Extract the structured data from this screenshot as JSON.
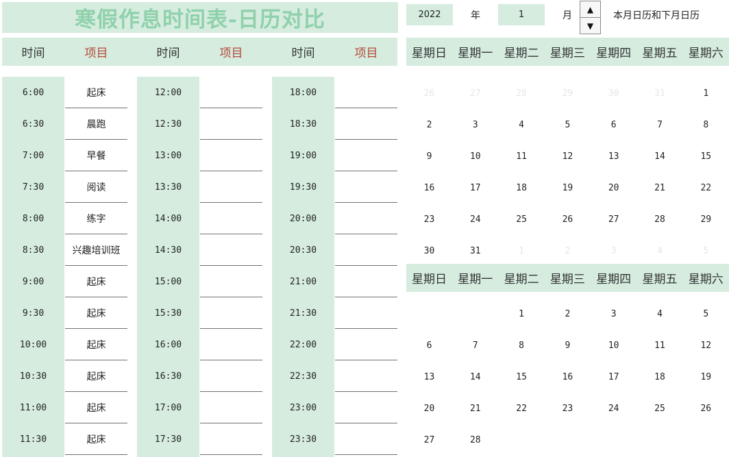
{
  "title": "寒假作息时间表-日历对比",
  "header": [
    "时间",
    "项目",
    "时间",
    "项目",
    "时间",
    "项目"
  ],
  "schedule": {
    "col1": {
      "times": [
        "6:00",
        "6:30",
        "7:00",
        "7:30",
        "8:00",
        "8:30",
        "9:00",
        "9:30",
        "10:00",
        "10:30",
        "11:00",
        "11:30"
      ],
      "items": [
        "起床",
        "晨跑",
        "早餐",
        "阅读",
        "练字",
        "兴趣培训班",
        "起床",
        "起床",
        "起床",
        "起床",
        "起床",
        "起床"
      ]
    },
    "col2": {
      "times": [
        "12:00",
        "12:30",
        "13:00",
        "13:30",
        "14:00",
        "14:30",
        "15:00",
        "15:30",
        "16:00",
        "16:30",
        "17:00",
        "17:30"
      ],
      "items": [
        "",
        "",
        "",
        "",
        "",
        "",
        "",
        "",
        "",
        "",
        "",
        ""
      ]
    },
    "col3": {
      "times": [
        "18:00",
        "18:30",
        "19:00",
        "19:30",
        "20:00",
        "20:30",
        "21:00",
        "21:30",
        "22:00",
        "22:30",
        "23:00",
        "23:30"
      ],
      "items": [
        "",
        "",
        "",
        "",
        "",
        "",
        "",
        "",
        "",
        "",
        "",
        ""
      ]
    }
  },
  "controls": {
    "year_value": "2022",
    "year_label": "年",
    "month_value": "1",
    "month_label": "月",
    "spinner_up": "▲",
    "spinner_down": "▼",
    "caption": "本月日历和下月日历"
  },
  "weekdays": [
    "星期日",
    "星期一",
    "星期二",
    "星期三",
    "星期四",
    "星期五",
    "星期六"
  ],
  "calendar_current": [
    [
      "26",
      "27",
      "28",
      "29",
      "30",
      "31",
      "1"
    ],
    [
      "2",
      "3",
      "4",
      "5",
      "6",
      "7",
      "8"
    ],
    [
      "9",
      "10",
      "11",
      "12",
      "13",
      "14",
      "15"
    ],
    [
      "16",
      "17",
      "18",
      "19",
      "20",
      "21",
      "22"
    ],
    [
      "23",
      "24",
      "25",
      "26",
      "27",
      "28",
      "29"
    ],
    [
      "30",
      "31",
      "1",
      "2",
      "3",
      "4",
      "5"
    ]
  ],
  "calendar_current_muted": [
    [
      true,
      true,
      true,
      true,
      true,
      true,
      false
    ],
    [
      false,
      false,
      false,
      false,
      false,
      false,
      false
    ],
    [
      false,
      false,
      false,
      false,
      false,
      false,
      false
    ],
    [
      false,
      false,
      false,
      false,
      false,
      false,
      false
    ],
    [
      false,
      false,
      false,
      false,
      false,
      false,
      false
    ],
    [
      false,
      false,
      true,
      true,
      true,
      true,
      true
    ]
  ],
  "calendar_next": [
    [
      "",
      "",
      "1",
      "2",
      "3",
      "4",
      "5"
    ],
    [
      "6",
      "7",
      "8",
      "9",
      "10",
      "11",
      "12"
    ],
    [
      "13",
      "14",
      "15",
      "16",
      "17",
      "18",
      "19"
    ],
    [
      "20",
      "21",
      "22",
      "23",
      "24",
      "25",
      "26"
    ],
    [
      "27",
      "28",
      "",
      "",
      "",
      "",
      ""
    ]
  ],
  "colors": {
    "mint": "#d5ecdf",
    "title": "#8fd1ab",
    "item_header": "#b64a3a",
    "muted_day": "#e6e6e6"
  }
}
